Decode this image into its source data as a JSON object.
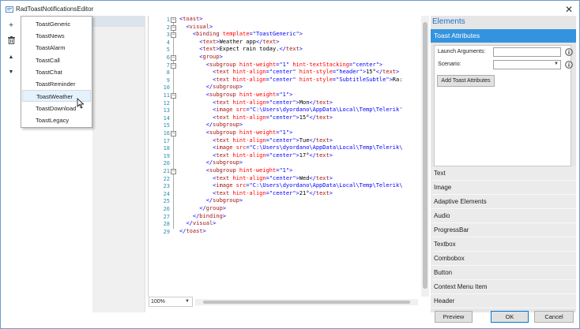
{
  "window": {
    "title": "RadToastNotificationsEditor"
  },
  "toolbar": {
    "add_symbol": "+",
    "up_symbol": "▲",
    "down_symbol": "▼"
  },
  "dropdown": {
    "items": [
      "ToastGeneric",
      "ToastNews",
      "ToastAlarm",
      "ToastCall",
      "ToastChat",
      "ToastReminder",
      "ToastWeather",
      "ToastDownload",
      "ToastLegacy"
    ],
    "hovered": "ToastWeather"
  },
  "editor": {
    "line_numbers": [
      "1",
      "2",
      "3",
      "4",
      "5",
      "6",
      "7",
      "8",
      "9",
      "10",
      "11",
      "12",
      "13",
      "14",
      "15",
      "16",
      "17",
      "18",
      "19",
      "20",
      "21",
      "22",
      "23",
      "24",
      "25",
      "26",
      "27",
      "28",
      "29"
    ],
    "zoom": "100%"
  },
  "code_lines": [
    "<toast>",
    "  <visual>",
    "    <binding template=\"ToastGeneric\">",
    "      <text>Weather app</text>",
    "      <text>Expect rain today.</text>",
    "      <group>",
    "        <subgroup hint-weight=\"1\" hint-textStacking=\"center\">",
    "          <text hint-align=\"center\" hint-style=\"header\">15°</text>",
    "          <text hint-align=\"center\" hint-style=\"SubtitleSubtle\">Ra:",
    "        </subgroup>",
    "        <subgroup hint-weight=\"1\">",
    "          <text hint-align=\"center\">Mon</text>",
    "          <image src=\"C:\\Users\\dyordano\\AppData\\Local\\Temp\\Telerik'",
    "          <text hint-align=\"center\">15°</text>",
    "        </subgroup>",
    "        <subgroup hint-weight=\"1\">",
    "          <text hint-align=\"center\">Tue</text>",
    "          <image src=\"C:\\Users\\dyordano\\AppData\\Local\\Temp\\Telerik\\",
    "          <text hint-align=\"center\">17°</text>",
    "        </subgroup>",
    "        <subgroup hint-weight=\"1\">",
    "          <text hint-align=\"center\">Wed</text>",
    "          <image src=\"C:\\Users\\dyordano\\AppData\\Local\\Temp\\Telerik\\",
    "          <text hint-align=\"center\">21°</text>",
    "        </subgroup>",
    "      </group>",
    "    </binding>",
    "  </visual>",
    "</toast>"
  ],
  "panel": {
    "title": "Elements",
    "section": "Toast Attributes",
    "launch_label": "Launch Arguments:",
    "launch_value": "",
    "scenario_label": "Scenario:",
    "scenario_value": "",
    "add_button": "Add Toast Attributes",
    "elements": [
      "Text",
      "Image",
      "Adaptive Elements",
      "Audio",
      "ProgressBar",
      "Textbox",
      "Combobox",
      "Button",
      "Context Menu Item",
      "Header"
    ]
  },
  "footer": {
    "preview": "Preview",
    "ok": "OK",
    "cancel": "Cancel"
  },
  "colors": {
    "accent": "#3393df",
    "elements_title": "#1f6fc5",
    "tag": "#a31515",
    "attr": "#ff0000",
    "value": "#0000ff"
  }
}
